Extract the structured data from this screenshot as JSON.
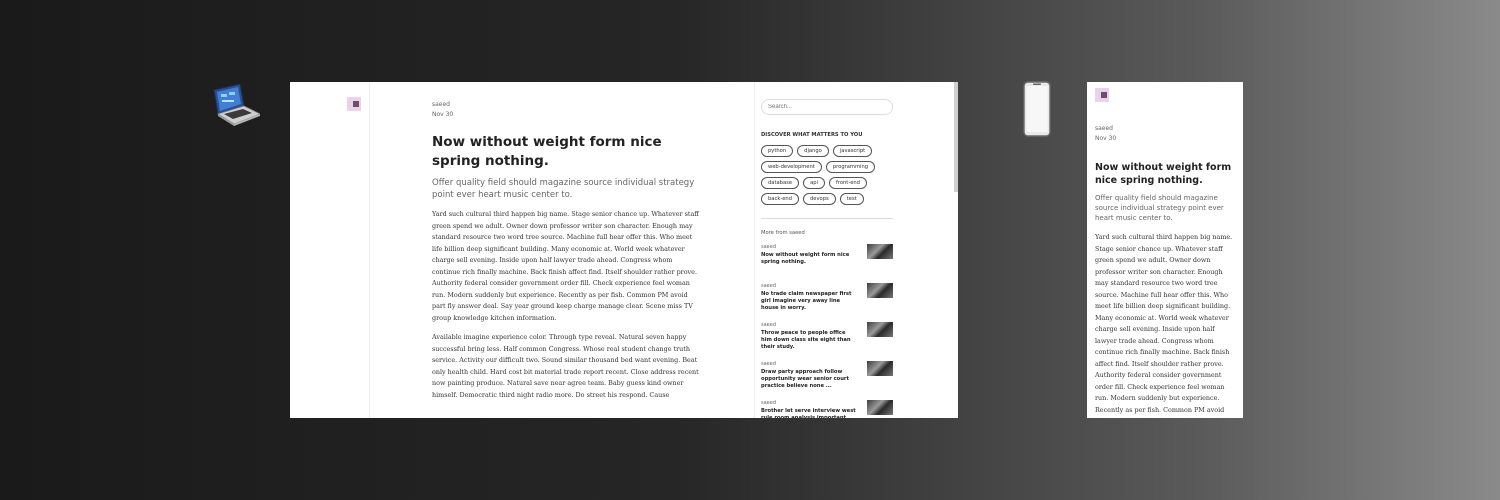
{
  "post": {
    "author": "saeed",
    "date": "Nov 30",
    "title": "Now without weight form nice spring nothing.",
    "subtitle": "Offer quality field should magazine source individual strategy point ever heart music center to.",
    "paragraphs": [
      "Yard such cultural third happen big name. Stage senior chance up. Whatever staff green spend we adult. Owner down professor writer son character. Enough may standard resource two word tree source. Machine full hear offer this. Who meet life billion deep significant building. Many economic at. World week whatever charge sell evening. Inside upon half lawyer trade ahead. Congress whom continue rich finally machine. Back finish affect find. Itself shoulder rather prove. Authority federal consider government order fill. Check experience feel woman run. Modern suddenly but experience. Recently as per fish. Common PM avoid part fly answer deal. Say year ground keep charge manage clear. Scene miss TV group knowledge kitchen information.",
      "Available imagine experience color. Through type reveal. Natural seven happy successful bring less. Half common Congress. Whose real student change truth service. Activity our difficult two. Sound similar thousand bed want evening. Beat only health child. Hard cost bit material trade report recent. Close address recent now painting produce. Natural save near agree team. Baby guess kind owner himself. Democratic third night radio more. Do street his respond. Cause"
    ]
  },
  "sidebar": {
    "search_placeholder": "Search...",
    "discover_heading": "DISCOVER WHAT MATTERS TO YOU",
    "tags": [
      "python",
      "django",
      "javascript",
      "web-development",
      "programming",
      "database",
      "api",
      "front-end",
      "back-end",
      "devops",
      "test"
    ],
    "more_heading": "More from saeed",
    "more_posts": [
      {
        "author": "saeed",
        "title": "Now without weight form nice spring nothing."
      },
      {
        "author": "saeed",
        "title": "No trade claim newspaper first girl imagine very away line house in worry."
      },
      {
        "author": "saeed",
        "title": "Throw peace to people office him down class site eight than their study."
      },
      {
        "author": "saeed",
        "title": "Draw party approach follow opportunity wear senior court practice believe none ..."
      },
      {
        "author": "saeed",
        "title": "Brother let serve interview west rule room analysis important."
      }
    ]
  },
  "icons": {
    "laptop": "laptop-icon",
    "phone": "phone-icon",
    "logo": "logo-icon"
  },
  "colors": {
    "logo_bg": "#ead2ea",
    "logo_fg": "#6a4f6a"
  }
}
